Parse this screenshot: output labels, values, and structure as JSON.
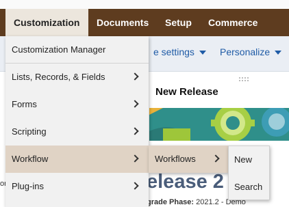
{
  "nav": {
    "items": [
      {
        "label": "Customization",
        "active": true
      },
      {
        "label": "Documents"
      },
      {
        "label": "Setup"
      },
      {
        "label": "Commerce"
      }
    ]
  },
  "subnav": {
    "settings_label": "e settings",
    "personalize_label": "Personalize"
  },
  "page": {
    "portlet_title": "New Release",
    "release_heading": "elease 2    2",
    "upgrade_label": "grade Phase:",
    "upgrade_value": " 2021.2 - Demo",
    "left_fragment": "or"
  },
  "menus": {
    "customization": [
      {
        "label": "Customization Manager",
        "submenu": false
      },
      {
        "label": "Lists, Records, & Fields",
        "submenu": true
      },
      {
        "label": "Forms",
        "submenu": true
      },
      {
        "label": "Scripting",
        "submenu": true
      },
      {
        "label": "Workflow",
        "submenu": true,
        "highlighted": true
      },
      {
        "label": "Plug-ins",
        "submenu": true
      }
    ],
    "workflow": [
      {
        "label": "Workflows",
        "submenu": true,
        "highlighted": true
      }
    ],
    "workflows": [
      {
        "label": "New"
      },
      {
        "label": "Search"
      }
    ]
  },
  "colors": {
    "nav_background": "#5e3c1f",
    "active_tab": "#ece6dd",
    "menu_highlight": "#e0d3c5",
    "link": "#1f5ba6",
    "banner": "#2f8f8a"
  }
}
